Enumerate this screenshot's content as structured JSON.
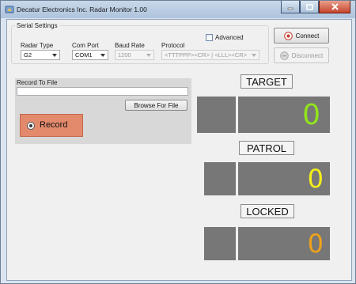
{
  "window": {
    "title": "Decatur Electronics Inc. Radar Monitor 1.00"
  },
  "serial": {
    "group_label": "Serial Settings",
    "advanced_label": "Advanced",
    "radar_type": {
      "label": "Radar Type",
      "value": "G2"
    },
    "com_port": {
      "label": "Com Port",
      "value": "COM1"
    },
    "baud_rate": {
      "label": "Baud Rate",
      "value": "1200"
    },
    "protocol": {
      "label": "Protocol",
      "value": "<TTTPPP><CR> | <LLL><CR>"
    }
  },
  "actions": {
    "connect": "Connect",
    "disconnect": "Disconnect"
  },
  "record": {
    "group_label": "Record To File",
    "file_path": "",
    "browse_label": "Browse For File",
    "record_label": "Record"
  },
  "readouts": [
    {
      "label": "TARGET",
      "value": "0",
      "color": "#92e41b"
    },
    {
      "label": "PATROL",
      "value": "0",
      "color": "#f4ef1a"
    },
    {
      "label": "LOCKED",
      "value": "0",
      "color": "#efa21b"
    }
  ]
}
